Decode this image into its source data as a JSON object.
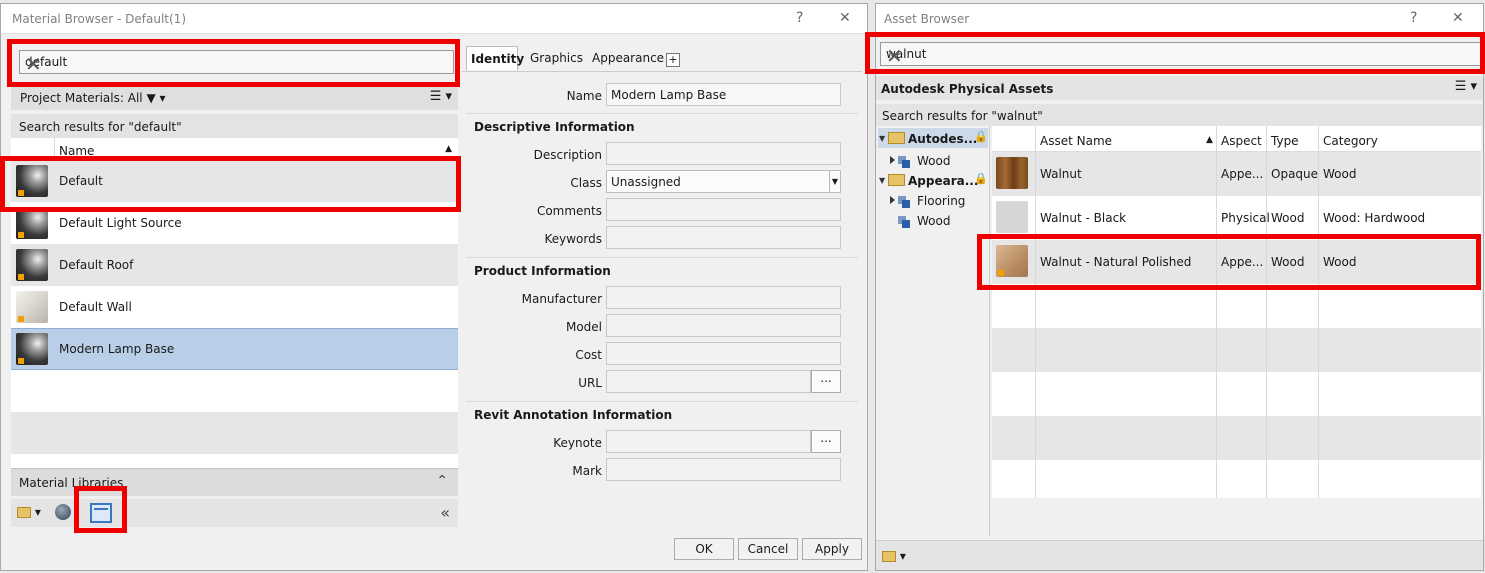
{
  "material_browser": {
    "title": "Material Browser - Default(1)",
    "help": "?",
    "close": "✕",
    "search_value": "default",
    "filter_label": "Project Materials: All",
    "results_label": "Search results for \"default\"",
    "col_name": "Name",
    "items": [
      {
        "name": "Default"
      },
      {
        "name": "Default Light Source"
      },
      {
        "name": "Default Roof"
      },
      {
        "name": "Default Wall"
      },
      {
        "name": "Modern Lamp Base"
      }
    ],
    "libraries_label": "Material Libraries",
    "tabs": [
      "Identity",
      "Graphics",
      "Appearance"
    ],
    "tab_add": "+",
    "identity": {
      "name_label": "Name",
      "name_value": "Modern Lamp Base",
      "descriptive_header": "Descriptive Information",
      "description_label": "Description",
      "class_label": "Class",
      "class_value": "Unassigned",
      "comments_label": "Comments",
      "keywords_label": "Keywords",
      "product_header": "Product Information",
      "manufacturer_label": "Manufacturer",
      "model_label": "Model",
      "cost_label": "Cost",
      "url_label": "URL",
      "revit_header": "Revit Annotation Information",
      "keynote_label": "Keynote",
      "mark_label": "Mark",
      "dots": "..."
    },
    "buttons": {
      "ok": "OK",
      "cancel": "Cancel",
      "apply": "Apply"
    }
  },
  "asset_browser": {
    "title": "Asset Browser",
    "help": "?",
    "close": "✕",
    "search_value": "walnut",
    "library_label": "Autodesk Physical Assets",
    "results_label": "Search results for \"walnut\"",
    "tree": {
      "node1": "Autodes...",
      "node1_child": "Wood",
      "node2": "Appeara...",
      "node2_child1": "Flooring",
      "node2_child2": "Wood"
    },
    "columns": {
      "asset_name": "Asset Name",
      "aspect": "Aspect",
      "type": "Type",
      "category": "Category"
    },
    "rows": [
      {
        "name": "Walnut",
        "aspect": "Appe...",
        "type": "Opaque",
        "category": "Wood"
      },
      {
        "name": "Walnut - Black",
        "aspect": "Physical",
        "type": "Wood",
        "category": "Wood: Hardwood"
      },
      {
        "name": "Walnut - Natural Polished",
        "aspect": "Appe...",
        "type": "Wood",
        "category": "Wood"
      }
    ]
  }
}
